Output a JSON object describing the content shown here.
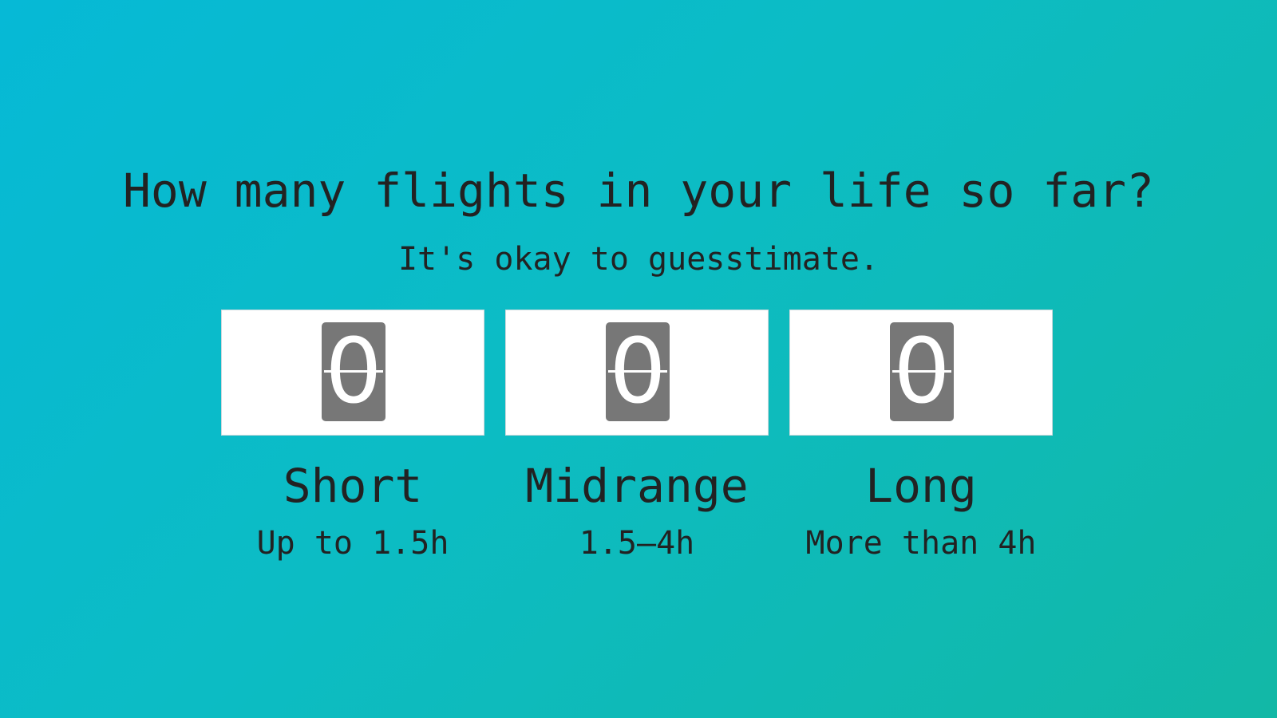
{
  "page": {
    "question": "How many flights in your life so far?",
    "subtitle": "It's okay to guesstimate."
  },
  "counters": [
    {
      "value": "0",
      "label": "Short",
      "range": "Up to 1.5h"
    },
    {
      "value": "0",
      "label": "Midrange",
      "range": "1.5–4h"
    },
    {
      "value": "0",
      "label": "Long",
      "range": "More than 4h"
    }
  ],
  "colors": {
    "background_start": "#06b9d6",
    "background_end": "#12b8a6",
    "text": "#222222",
    "card": "#ffffff",
    "flip_digit_bg": "#777777"
  }
}
